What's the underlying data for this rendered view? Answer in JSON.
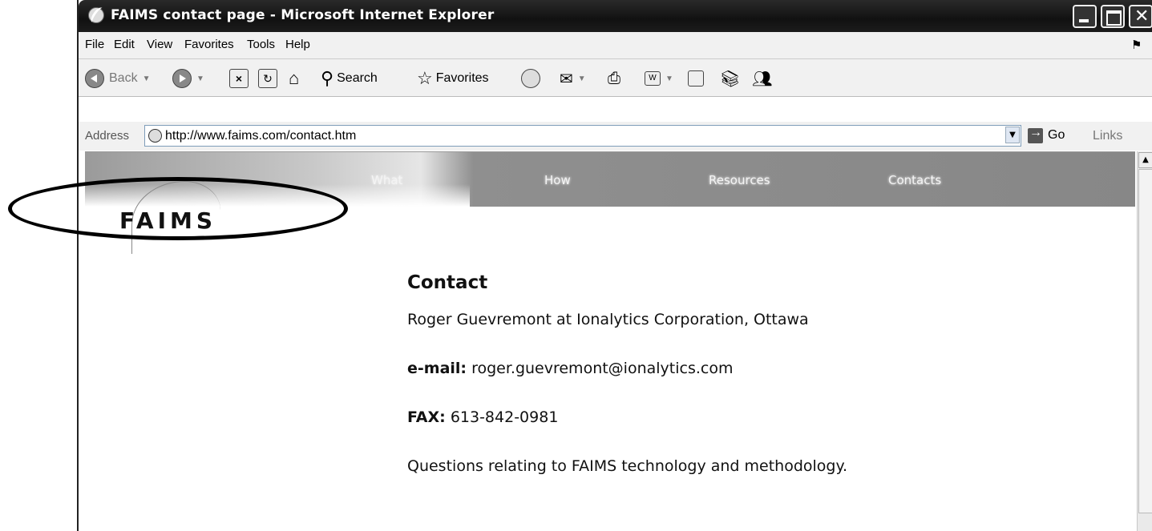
{
  "window": {
    "title": "FAIMS contact page - Microsoft Internet Explorer"
  },
  "menu": {
    "items": [
      "File",
      "Edit",
      "View",
      "Favorites",
      "Tools",
      "Help"
    ]
  },
  "toolbar": {
    "back_label": "Back",
    "search_label": "Search",
    "favorites_label": "Favorites"
  },
  "address": {
    "label": "Address",
    "url": "http://www.faims.com/contact.htm",
    "go_label": "Go",
    "links_label": "Links"
  },
  "site": {
    "logo": "FAIMS",
    "nav": [
      "What",
      "How",
      "Resources",
      "Contacts"
    ]
  },
  "contact": {
    "heading": "Contact",
    "line1": "Roger Guevremont at Ionalytics Corporation, Ottawa",
    "email_label": "e-mail:",
    "email_value": "roger.guevremont@ionalytics.com",
    "fax_label": "FAX:",
    "fax_value": "613-842-0981",
    "questions": "Questions relating to FAIMS technology and methodology."
  }
}
